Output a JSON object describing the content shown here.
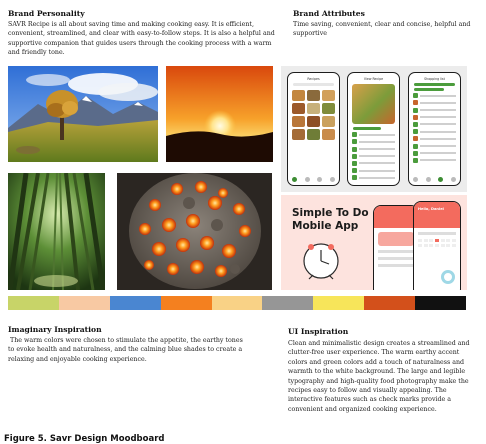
{
  "brand_personality": {
    "heading": "Brand Personality",
    "lines": [
      "SAVR Recipe is all about saving time and making cooking easy. It is efficient,",
      "convenient, streamlined, and clear with easy-to-follow steps. It is also a helpful and",
      "supportive companion that guides users through the cooking process with a warm",
      "and friendly tone."
    ]
  },
  "brand_attributes": {
    "heading": "Brand Attributes",
    "lines": [
      "Time saving, convenient, clear and concise, helpful and",
      "supportive"
    ]
  },
  "mockups": {
    "recipe_app": {
      "screen_titles": [
        "Recipes",
        "View Recipe",
        "Shopping list"
      ]
    },
    "todo_app": {
      "title_lines": [
        "Simple To Do",
        "Mobile App"
      ],
      "greeting": "Hello, Daniel"
    }
  },
  "palette": {
    "colors": [
      "#c8d468",
      "#f8c9a3",
      "#4a86d1",
      "#f4801f",
      "#f9d286",
      "#969696",
      "#f7e55a",
      "#d3501b",
      "#111111"
    ]
  },
  "imaginary_inspiration": {
    "heading": "Imaginary Inspiration",
    "lines": [
      " The warm colors were chosen to stimulate the appetite, the earthy tones",
      "to evoke health and naturalness, and the calming blue shades to create a",
      "relaxing and enjoyable cooking experience."
    ]
  },
  "ui_inspiration": {
    "heading": "UI Inspiration",
    "lines": [
      "Clean and minimalistic design creates a streamlined and",
      "clutter-free user experience. The warm earthy accent",
      "colors and green colors add a touch of naturalness and",
      "warmth to the white background. The large and legible",
      "typography and high-quality food photography make the",
      "recipes easy to follow and visually appealing. The",
      "interactive features such as check marks provide a",
      "convenient and organized cooking experience."
    ]
  },
  "caption": "Figure 5. Savr Design Moodboard"
}
